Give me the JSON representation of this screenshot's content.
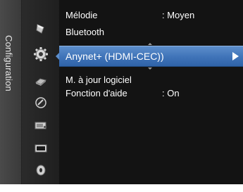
{
  "side_tab": {
    "label": "Configuration"
  },
  "icons": [
    {
      "name": "picture-icon"
    },
    {
      "name": "setup-gear-icon"
    },
    {
      "name": "input-icon"
    },
    {
      "name": "application-icon"
    },
    {
      "name": "support-icon"
    },
    {
      "name": "screen-icon"
    },
    {
      "name": "disc-icon"
    }
  ],
  "menu": {
    "items": [
      {
        "label": "Mélodie",
        "value": ": Moyen"
      },
      {
        "label": "Bluetooth",
        "value": ""
      },
      {
        "label": "Anynet+ (HDMI-CEC))",
        "value": "",
        "selected": true
      },
      {
        "label": "M. à jour logiciel",
        "value": ""
      },
      {
        "label": "Fonction d'aide",
        "value": ": On"
      }
    ]
  },
  "colors": {
    "highlight": "#3f73b8",
    "background": "#131313",
    "text": "#ffffff"
  }
}
